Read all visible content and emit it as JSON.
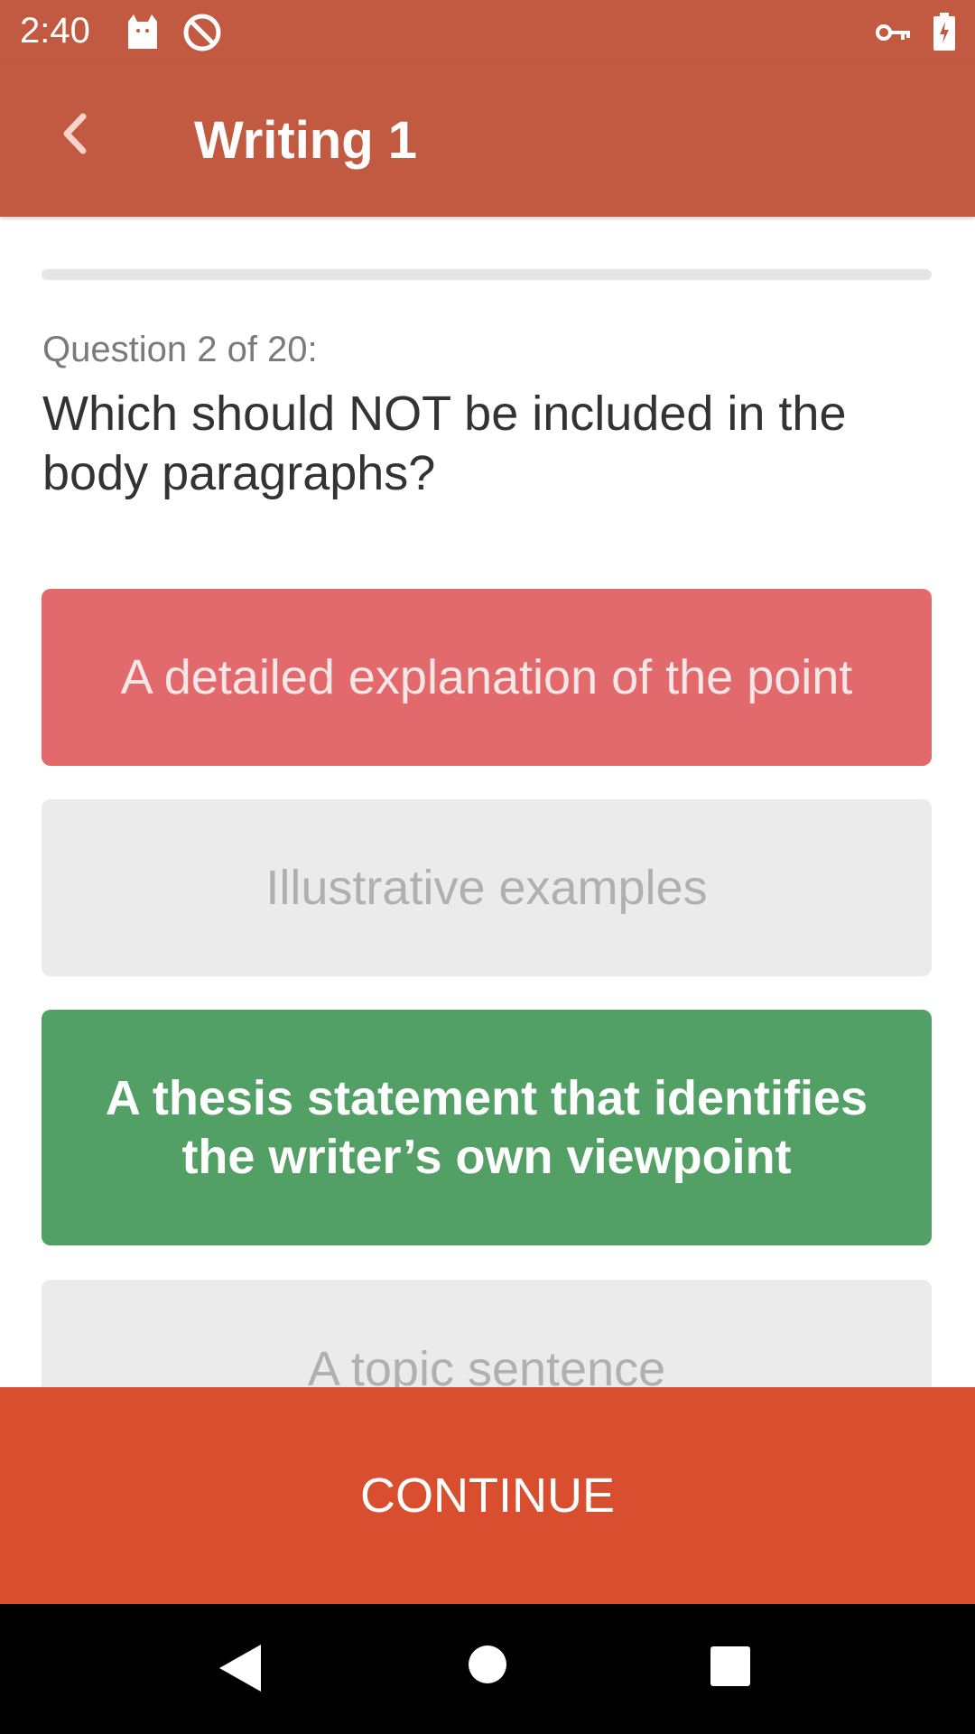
{
  "status_bar": {
    "time": "2:40",
    "icons": [
      "cat-notification-icon",
      "do-not-disturb-icon",
      "vpn-key-icon",
      "battery-charging-icon"
    ]
  },
  "app_bar": {
    "title": "Writing 1",
    "back_icon": "chevron-left-icon"
  },
  "progress": {
    "fraction": 0.0
  },
  "question": {
    "label": "Question 2 of 20:",
    "text": "Which should NOT be included in the body paragraphs?"
  },
  "answers": [
    {
      "text": "A detailed explanation of the point",
      "state": "wrong"
    },
    {
      "text": "Illustrative examples",
      "state": "neutral"
    },
    {
      "text": "A thesis statement that identifies the writer’s own viewpoint",
      "state": "correct"
    },
    {
      "text": "A topic sentence",
      "state": "neutral"
    }
  ],
  "continue_label": "CONTINUE",
  "nav_bar": {
    "icons": [
      "back-triangle-icon",
      "home-circle-icon",
      "recents-square-icon"
    ]
  },
  "colors": {
    "primary": "#c25a42",
    "wrong": "#e26a6d",
    "correct": "#52a065",
    "neutral": "#ebebeb",
    "continue": "#d84e2e"
  }
}
